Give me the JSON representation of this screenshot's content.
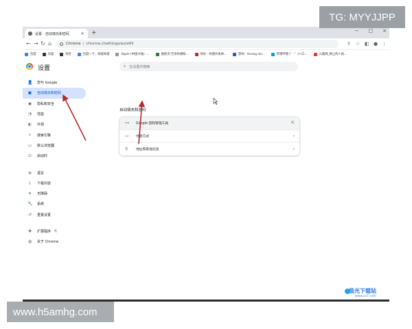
{
  "tab": {
    "title": "设置 - 自动填充和密码",
    "close": "×",
    "new": "+"
  },
  "window_controls": [
    "−",
    "□",
    "×"
  ],
  "omnibox": {
    "site": "Chrome",
    "separator": "|",
    "url": "chrome://settings/autofill"
  },
  "bookmarks": [
    {
      "label": "百度",
      "color": "#3385ff"
    },
    {
      "label": "天猫",
      "color": "#333333"
    },
    {
      "label": "淘宝",
      "color": "#333333"
    },
    {
      "label": "百度一下，你就知道",
      "color": "#3385ff"
    },
    {
      "label": "Apple (中国大陆) -...",
      "color": "#999999"
    },
    {
      "label": "搜索页-告诉你想知...",
      "color": "#2e7d32"
    },
    {
      "label": "快乐 - 构建开发体...",
      "color": "#c62828"
    },
    {
      "label": "影响 - Huang lao...",
      "color": "#1565c0"
    },
    {
      "label": "哔哩哔哩 (゜-゜)つロ...",
      "color": "#00a1d6"
    },
    {
      "label": "火狐网_网上的人民...",
      "color": "#e53935"
    }
  ],
  "settings": {
    "title": "设置",
    "search_placeholder": "在设置中搜索",
    "sidebar": [
      {
        "label": "您与 Google",
        "icon": "person-icon",
        "glyph": "👤"
      },
      {
        "label": "自动填充和密码",
        "icon": "autofill-icon",
        "glyph": "▣",
        "active": true
      },
      {
        "label": "隐私和安全",
        "icon": "shield-icon",
        "glyph": "◉"
      },
      {
        "label": "性能",
        "icon": "performance-icon",
        "glyph": "◔"
      },
      {
        "label": "外观",
        "icon": "palette-icon",
        "glyph": "◐"
      },
      {
        "label": "搜索引擎",
        "icon": "search-icon",
        "glyph": "⌕"
      },
      {
        "label": "默认浏览器",
        "icon": "browser-icon",
        "glyph": "▭"
      },
      {
        "label": "启动时",
        "icon": "power-icon",
        "glyph": "⏻"
      }
    ],
    "sidebar2": [
      {
        "label": "语言",
        "icon": "globe-icon",
        "glyph": "⊕"
      },
      {
        "label": "下载内容",
        "icon": "download-icon",
        "glyph": "⤓"
      },
      {
        "label": "无障碍",
        "icon": "accessibility-icon",
        "glyph": "✦"
      },
      {
        "label": "系统",
        "icon": "wrench-icon",
        "glyph": "🔧"
      },
      {
        "label": "重置设置",
        "icon": "reset-icon",
        "glyph": "↺"
      }
    ],
    "sidebar3": [
      {
        "label": "扩展程序",
        "icon": "puzzle-icon",
        "glyph": "✚",
        "external": "⇱"
      },
      {
        "label": "关于 Chrome",
        "icon": "chrome-icon",
        "glyph": "◍"
      }
    ],
    "section_title": "自动填充和密码",
    "rows": [
      {
        "label": "Google 密码管理工具",
        "icon": "key-icon",
        "glyph": "⊶",
        "trailing": "⇱"
      },
      {
        "label": "付款方式",
        "icon": "card-icon",
        "glyph": "▭",
        "trailing": "›"
      },
      {
        "label": "地址和其他信息",
        "icon": "location-icon",
        "glyph": "⚲",
        "trailing": "›"
      }
    ]
  },
  "watermarks": {
    "top": "TG: MYYJJPP",
    "bottom": "www.h5amhg.com",
    "logo_line1": "极光下载站",
    "logo_line2": "www.xz7.com"
  }
}
